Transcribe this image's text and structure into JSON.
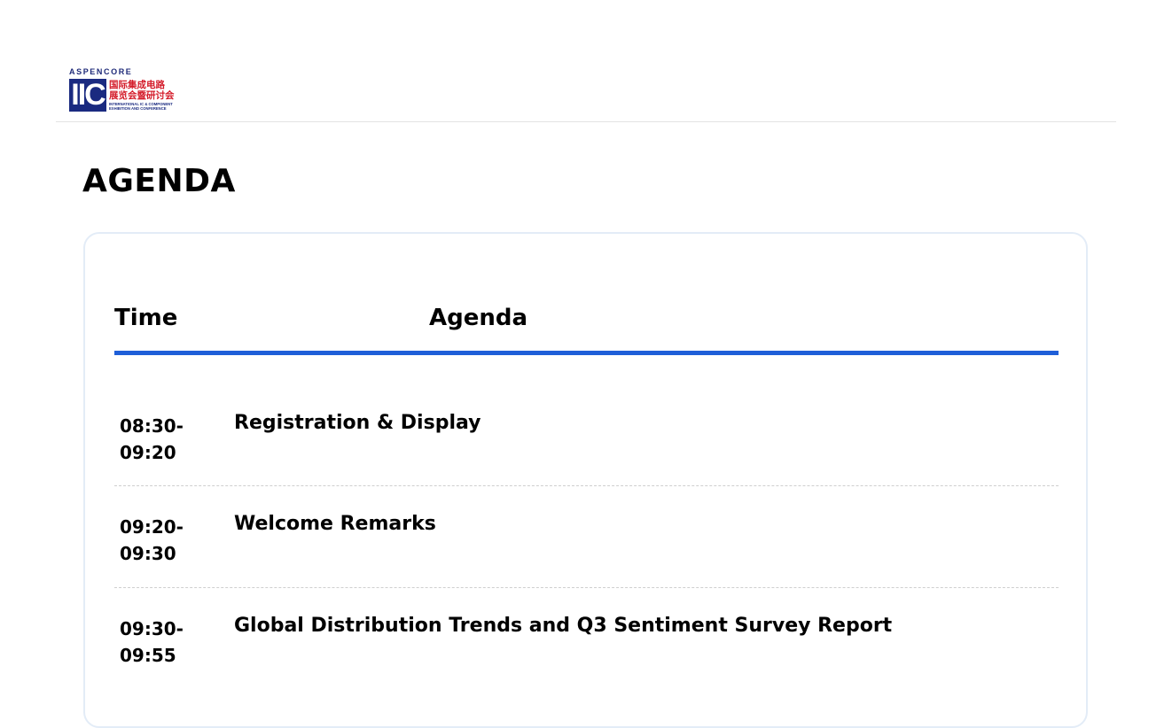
{
  "logo": {
    "brand": "ASPENCORE",
    "mark": "IIC",
    "cn_line1": "国际集成电路",
    "cn_line2": "展览会暨研讨会",
    "en_line1": "INTERNATIONAL IC & COMPONENT",
    "en_line2": "EXHIBITION AND CONFERENCE"
  },
  "page_title": "AGENDA",
  "table": {
    "columns": [
      "Time",
      "Agenda"
    ],
    "rows": [
      {
        "time_start": "08:30-",
        "time_end": "09:20",
        "topic": "Registration & Display"
      },
      {
        "time_start": "09:20-",
        "time_end": "09:30",
        "topic": "Welcome Remarks"
      },
      {
        "time_start": "09:30-",
        "time_end": "09:55",
        "topic": "Global Distribution Trends and Q3 Sentiment Survey Report"
      }
    ]
  },
  "colors": {
    "accent_rule": "#1e5fd8",
    "logo_navy": "#1a2a80",
    "logo_red": "#d41c2a",
    "card_border": "#e3ecf7"
  }
}
